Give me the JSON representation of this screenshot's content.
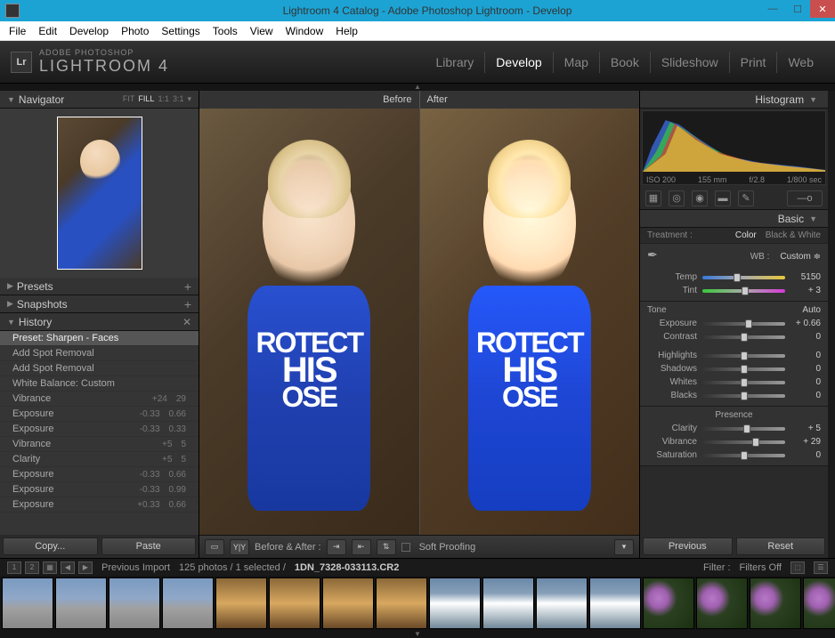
{
  "titlebar": {
    "text": "Lightroom 4 Catalog - Adobe Photoshop Lightroom - Develop"
  },
  "menubar": [
    "File",
    "Edit",
    "Develop",
    "Photo",
    "Settings",
    "Tools",
    "View",
    "Window",
    "Help"
  ],
  "brand": {
    "top": "ADOBE PHOTOSHOP",
    "bottom": "LIGHTROOM 4",
    "logo": "Lr"
  },
  "modules": [
    "Library",
    "Develop",
    "Map",
    "Book",
    "Slideshow",
    "Print",
    "Web"
  ],
  "active_module": "Develop",
  "navigator": {
    "title": "Navigator",
    "options": [
      "FIT",
      "FILL",
      "1:1",
      "3:1"
    ],
    "active_option": "FILL"
  },
  "panels_left": {
    "presets": "Presets",
    "snapshots": "Snapshots",
    "history": "History"
  },
  "history": [
    {
      "label": "Preset: Sharpen - Faces",
      "active": true
    },
    {
      "label": "Add Spot Removal"
    },
    {
      "label": "Add Spot Removal"
    },
    {
      "label": "White Balance: Custom"
    },
    {
      "label": "Vibrance",
      "v1": "+24",
      "v2": "29"
    },
    {
      "label": "Exposure",
      "v1": "-0.33",
      "v2": "0.66"
    },
    {
      "label": "Exposure",
      "v1": "-0.33",
      "v2": "0.33"
    },
    {
      "label": "Vibrance",
      "v1": "+5",
      "v2": "5"
    },
    {
      "label": "Clarity",
      "v1": "+5",
      "v2": "5"
    },
    {
      "label": "Exposure",
      "v1": "-0.33",
      "v2": "0.66"
    },
    {
      "label": "Exposure",
      "v1": "-0.33",
      "v2": "0.99"
    },
    {
      "label": "Exposure",
      "v1": "+0.33",
      "v2": "0.66"
    }
  ],
  "copy_btn": "Copy...",
  "paste_btn": "Paste",
  "before_label": "Before",
  "after_label": "After",
  "center_toolbar": {
    "before_after": "Before & After :",
    "soft_proofing": "Soft Proofing"
  },
  "shirt": {
    "line1": "ROTECT",
    "line2": "HIS",
    "line3": "OSE"
  },
  "previous_btn": "Previous",
  "reset_btn": "Reset",
  "histogram": {
    "title": "Histogram",
    "iso": "ISO 200",
    "focal": "155 mm",
    "aperture": "f/2.8",
    "shutter": "1/800 sec"
  },
  "basic_panel": {
    "title": "Basic",
    "treatment_label": "Treatment :",
    "color": "Color",
    "bw": "Black & White",
    "wb_label": "WB :",
    "wb_value": "Custom",
    "temp": {
      "label": "Temp",
      "value": "5150",
      "pos": 42
    },
    "tint": {
      "label": "Tint",
      "value": "+ 3",
      "pos": 52
    },
    "tone_label": "Tone",
    "auto": "Auto",
    "exposure": {
      "label": "Exposure",
      "value": "+ 0.66",
      "pos": 56
    },
    "contrast": {
      "label": "Contrast",
      "value": "0",
      "pos": 50
    },
    "highlights": {
      "label": "Highlights",
      "value": "0",
      "pos": 50
    },
    "shadows": {
      "label": "Shadows",
      "value": "0",
      "pos": 50
    },
    "whites": {
      "label": "Whites",
      "value": "0",
      "pos": 50
    },
    "blacks": {
      "label": "Blacks",
      "value": "0",
      "pos": 50
    },
    "presence_label": "Presence",
    "clarity": {
      "label": "Clarity",
      "value": "+ 5",
      "pos": 54
    },
    "vibrance": {
      "label": "Vibrance",
      "value": "+ 29",
      "pos": 65
    },
    "saturation": {
      "label": "Saturation",
      "value": "0",
      "pos": 50
    }
  },
  "filmstrip_info": {
    "source": "Previous Import",
    "count": "125 photos / 1 selected /",
    "filename": "1DN_7328-033113.CR2",
    "filter_label": "Filter :",
    "filter_value": "Filters Off"
  }
}
